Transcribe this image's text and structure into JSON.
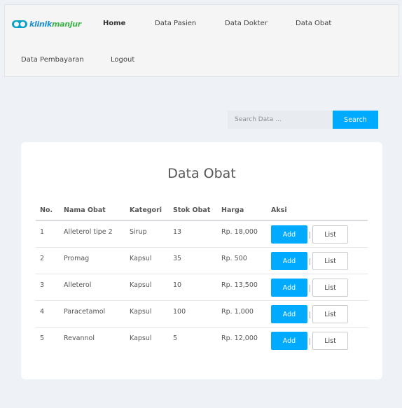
{
  "navbar": {
    "logo_text_a": "klinik",
    "logo_text_b": "manjur",
    "links": [
      "Home",
      "Data Pasien",
      "Data Dokter",
      "Data Obat",
      "Data Pembayaran",
      "Logout"
    ]
  },
  "search": {
    "placeholder": "Search Data ...",
    "button_label": "Search"
  },
  "main": {
    "title": "Data Obat",
    "columns": [
      "No.",
      "Nama Obat",
      "Kategori",
      "Stok Obat",
      "Harga",
      "Aksi"
    ],
    "rows": [
      {
        "no": "1",
        "nama": "Alleterol tipe 2",
        "kategori": "Sirup",
        "stok": "13",
        "harga": "Rp. 18,000"
      },
      {
        "no": "2",
        "nama": "Promag",
        "kategori": "Kapsul",
        "stok": "35",
        "harga": "Rp. 500"
      },
      {
        "no": "3",
        "nama": "Alleterol",
        "kategori": "Kapsul",
        "stok": "10",
        "harga": "Rp. 13,500"
      },
      {
        "no": "4",
        "nama": "Paracetamol",
        "kategori": "Kapsul",
        "stok": "100",
        "harga": "Rp. 1,000"
      },
      {
        "no": "5",
        "nama": "Revannol",
        "kategori": "Kapsul",
        "stok": "5",
        "harga": "Rp. 12,000"
      }
    ],
    "add_label": "Add",
    "list_label": "List"
  },
  "colors": {
    "accent": "#00aaff",
    "background": "#eef1f5",
    "navbar": "#f5f5f5"
  }
}
